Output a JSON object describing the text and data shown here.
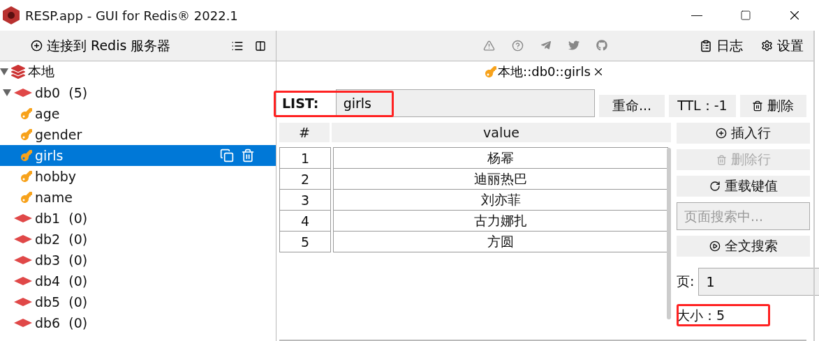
{
  "window": {
    "title": "RESP.app - GUI for Redis® 2022.1"
  },
  "sidebar": {
    "connect_button": "连接到 Redis 服务器",
    "tree": [
      {
        "label": "本地",
        "kind": "server",
        "expanded": true,
        "children": [
          {
            "label": "db0",
            "count": "(5)",
            "kind": "db",
            "expanded": true,
            "children": [
              {
                "label": "age",
                "kind": "key",
                "selected": false
              },
              {
                "label": "gender",
                "kind": "key",
                "selected": false
              },
              {
                "label": "girls",
                "kind": "key",
                "selected": true
              },
              {
                "label": "hobby",
                "kind": "key",
                "selected": false
              },
              {
                "label": "name",
                "kind": "key",
                "selected": false
              }
            ]
          },
          {
            "label": "db1",
            "count": "(0)",
            "kind": "db",
            "expanded": false
          },
          {
            "label": "db2",
            "count": "(0)",
            "kind": "db",
            "expanded": false
          },
          {
            "label": "db3",
            "count": "(0)",
            "kind": "db",
            "expanded": false
          },
          {
            "label": "db4",
            "count": "(0)",
            "kind": "db",
            "expanded": false
          },
          {
            "label": "db5",
            "count": "(0)",
            "kind": "db",
            "expanded": false
          },
          {
            "label": "db6",
            "count": "(0)",
            "kind": "db",
            "expanded": false
          }
        ]
      }
    ]
  },
  "toolbar": {
    "buttons": [
      {
        "label": "日志",
        "kind": "log"
      },
      {
        "label": "设置",
        "kind": "settings"
      }
    ]
  },
  "tabs": [
    {
      "label": "本地::db0::girls",
      "selected": true
    }
  ],
  "key": {
    "type": "LIST:",
    "name": "girls",
    "highlighted": true,
    "buttons": [
      {
        "label": "重命...",
        "kind": "rename"
      },
      {
        "label": "TTL：-1",
        "kind": "ttl"
      },
      {
        "label": "删除",
        "kind": "delete"
      }
    ]
  },
  "table": {
    "columns": [
      "#",
      "value"
    ],
    "rows": [
      [
        "1",
        "杨幂"
      ],
      [
        "2",
        "迪丽热巴"
      ],
      [
        "3",
        "刘亦菲"
      ],
      [
        "4",
        "古力娜扎"
      ],
      [
        "5",
        "方圆"
      ]
    ]
  },
  "actions": [
    {
      "kind": "insert",
      "label": "插入行",
      "disabled": false
    },
    {
      "kind": "delete",
      "label": "删除行",
      "disabled": true
    },
    {
      "kind": "reload",
      "label": "重载键值",
      "disabled": false
    },
    {
      "kind": "search",
      "placeholder": "页面搜索中..."
    },
    {
      "kind": "fulltext",
      "label": "全文搜索",
      "disabled": false
    }
  ],
  "page": {
    "label": "页:",
    "value": "1"
  },
  "size": {
    "text": "大小：5",
    "highlighted": true
  }
}
